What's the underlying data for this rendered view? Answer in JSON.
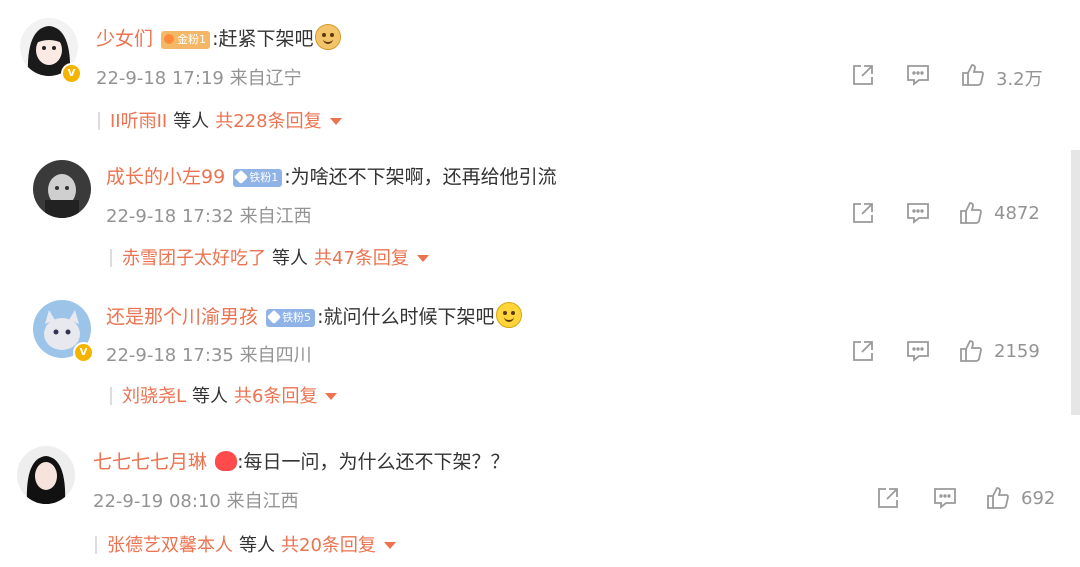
{
  "comments": [
    {
      "username": "少女们",
      "badge": "金粉1",
      "badge_type": "gold",
      "text": ":赶紧下架吧",
      "emoji": "dog-emoji",
      "time": "22-9-18 17:19",
      "location": "来自辽宁",
      "likes": "3.2万",
      "reply_user": "II听雨II",
      "reply_etc": "等人",
      "reply_total": "共228条回复",
      "verified": true
    },
    {
      "username": "成长的小左99",
      "badge": "铁粉1",
      "badge_type": "iron",
      "text": ":为啥还不下架啊，还再给他引流",
      "emoji": "",
      "time": "22-9-18 17:32",
      "location": "来自江西",
      "likes": "4872",
      "reply_user": "赤雪团子太好吃了",
      "reply_etc": "等人",
      "reply_total": "共47条回复",
      "verified": false
    },
    {
      "username": "还是那个川渝男孩",
      "badge": "铁粉5",
      "badge_type": "iron",
      "text": ":就问什么时候下架吧",
      "emoji": "smile-emoji",
      "time": "22-9-18 17:35",
      "location": "来自四川",
      "likes": "2159",
      "reply_user": "刘骁尧L",
      "reply_etc": "等人",
      "reply_total": "共6条回复",
      "verified": true
    },
    {
      "username": "七七七七月琳",
      "badge": "",
      "badge_type": "heart",
      "text": ":每日一问，为什么还不下架？？",
      "emoji": "",
      "time": "22-9-19 08:10",
      "location": "来自江西",
      "likes": "692",
      "reply_user": "张德艺双馨本人",
      "reply_etc": "等人",
      "reply_total": "共20条回复",
      "verified": false
    }
  ],
  "colors": {
    "accent": "#eb7350",
    "meta": "#939393",
    "text": "#333333"
  },
  "icons": [
    "share-icon",
    "comment-icon",
    "like-icon",
    "dropdown-caret-icon",
    "verified-icon"
  ]
}
